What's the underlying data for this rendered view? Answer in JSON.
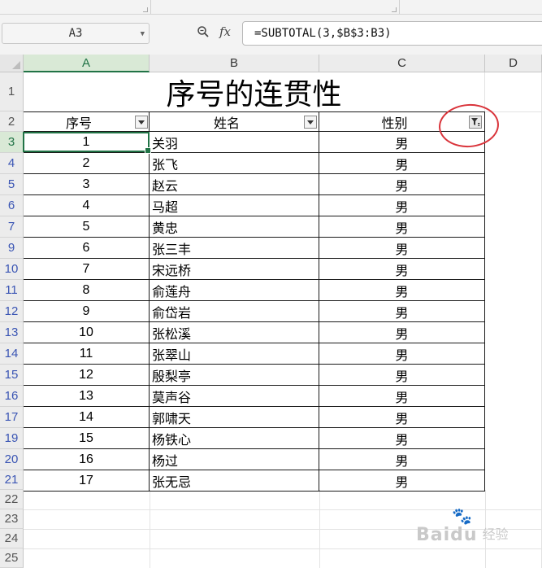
{
  "formula_bar": {
    "name_box": "A3",
    "fx_label": "fx",
    "formula": "=SUBTOTAL(3,$B$3:B3)"
  },
  "columns": [
    "A",
    "B",
    "C",
    "D"
  ],
  "active_column": "A",
  "active_row": "3",
  "title": "序号的连贯性",
  "headers": {
    "seq": "序号",
    "name": "姓名",
    "gender": "性别"
  },
  "rows": [
    {
      "row": "3",
      "seq": "1",
      "name": "关羽",
      "gender": "男"
    },
    {
      "row": "4",
      "seq": "2",
      "name": "张飞",
      "gender": "男"
    },
    {
      "row": "5",
      "seq": "3",
      "name": "赵云",
      "gender": "男"
    },
    {
      "row": "6",
      "seq": "4",
      "name": "马超",
      "gender": "男"
    },
    {
      "row": "7",
      "seq": "5",
      "name": "黄忠",
      "gender": "男"
    },
    {
      "row": "9",
      "seq": "6",
      "name": "张三丰",
      "gender": "男"
    },
    {
      "row": "10",
      "seq": "7",
      "name": "宋远桥",
      "gender": "男"
    },
    {
      "row": "11",
      "seq": "8",
      "name": "俞莲舟",
      "gender": "男"
    },
    {
      "row": "12",
      "seq": "9",
      "name": "俞岱岩",
      "gender": "男"
    },
    {
      "row": "13",
      "seq": "10",
      "name": "张松溪",
      "gender": "男"
    },
    {
      "row": "14",
      "seq": "11",
      "name": "张翠山",
      "gender": "男"
    },
    {
      "row": "15",
      "seq": "12",
      "name": "殷梨亭",
      "gender": "男"
    },
    {
      "row": "16",
      "seq": "13",
      "name": "莫声谷",
      "gender": "男"
    },
    {
      "row": "17",
      "seq": "14",
      "name": "郭啸天",
      "gender": "男"
    },
    {
      "row": "19",
      "seq": "15",
      "name": "杨铁心",
      "gender": "男"
    },
    {
      "row": "20",
      "seq": "16",
      "name": "杨过",
      "gender": "男"
    },
    {
      "row": "21",
      "seq": "17",
      "name": "张无忌",
      "gender": "男"
    }
  ],
  "row_headers": [
    "1",
    "2",
    "3",
    "4",
    "5",
    "6",
    "7",
    "9",
    "10",
    "11",
    "12",
    "13",
    "14",
    "15",
    "16",
    "17",
    "19",
    "20",
    "21",
    "22",
    "23",
    "24",
    "25"
  ],
  "watermark": {
    "brand": "Baidu",
    "suffix": "经验"
  },
  "colors": {
    "accent_green": "#217346",
    "row_number_blue": "#3a55b4",
    "annotation_red": "#d9333a"
  }
}
